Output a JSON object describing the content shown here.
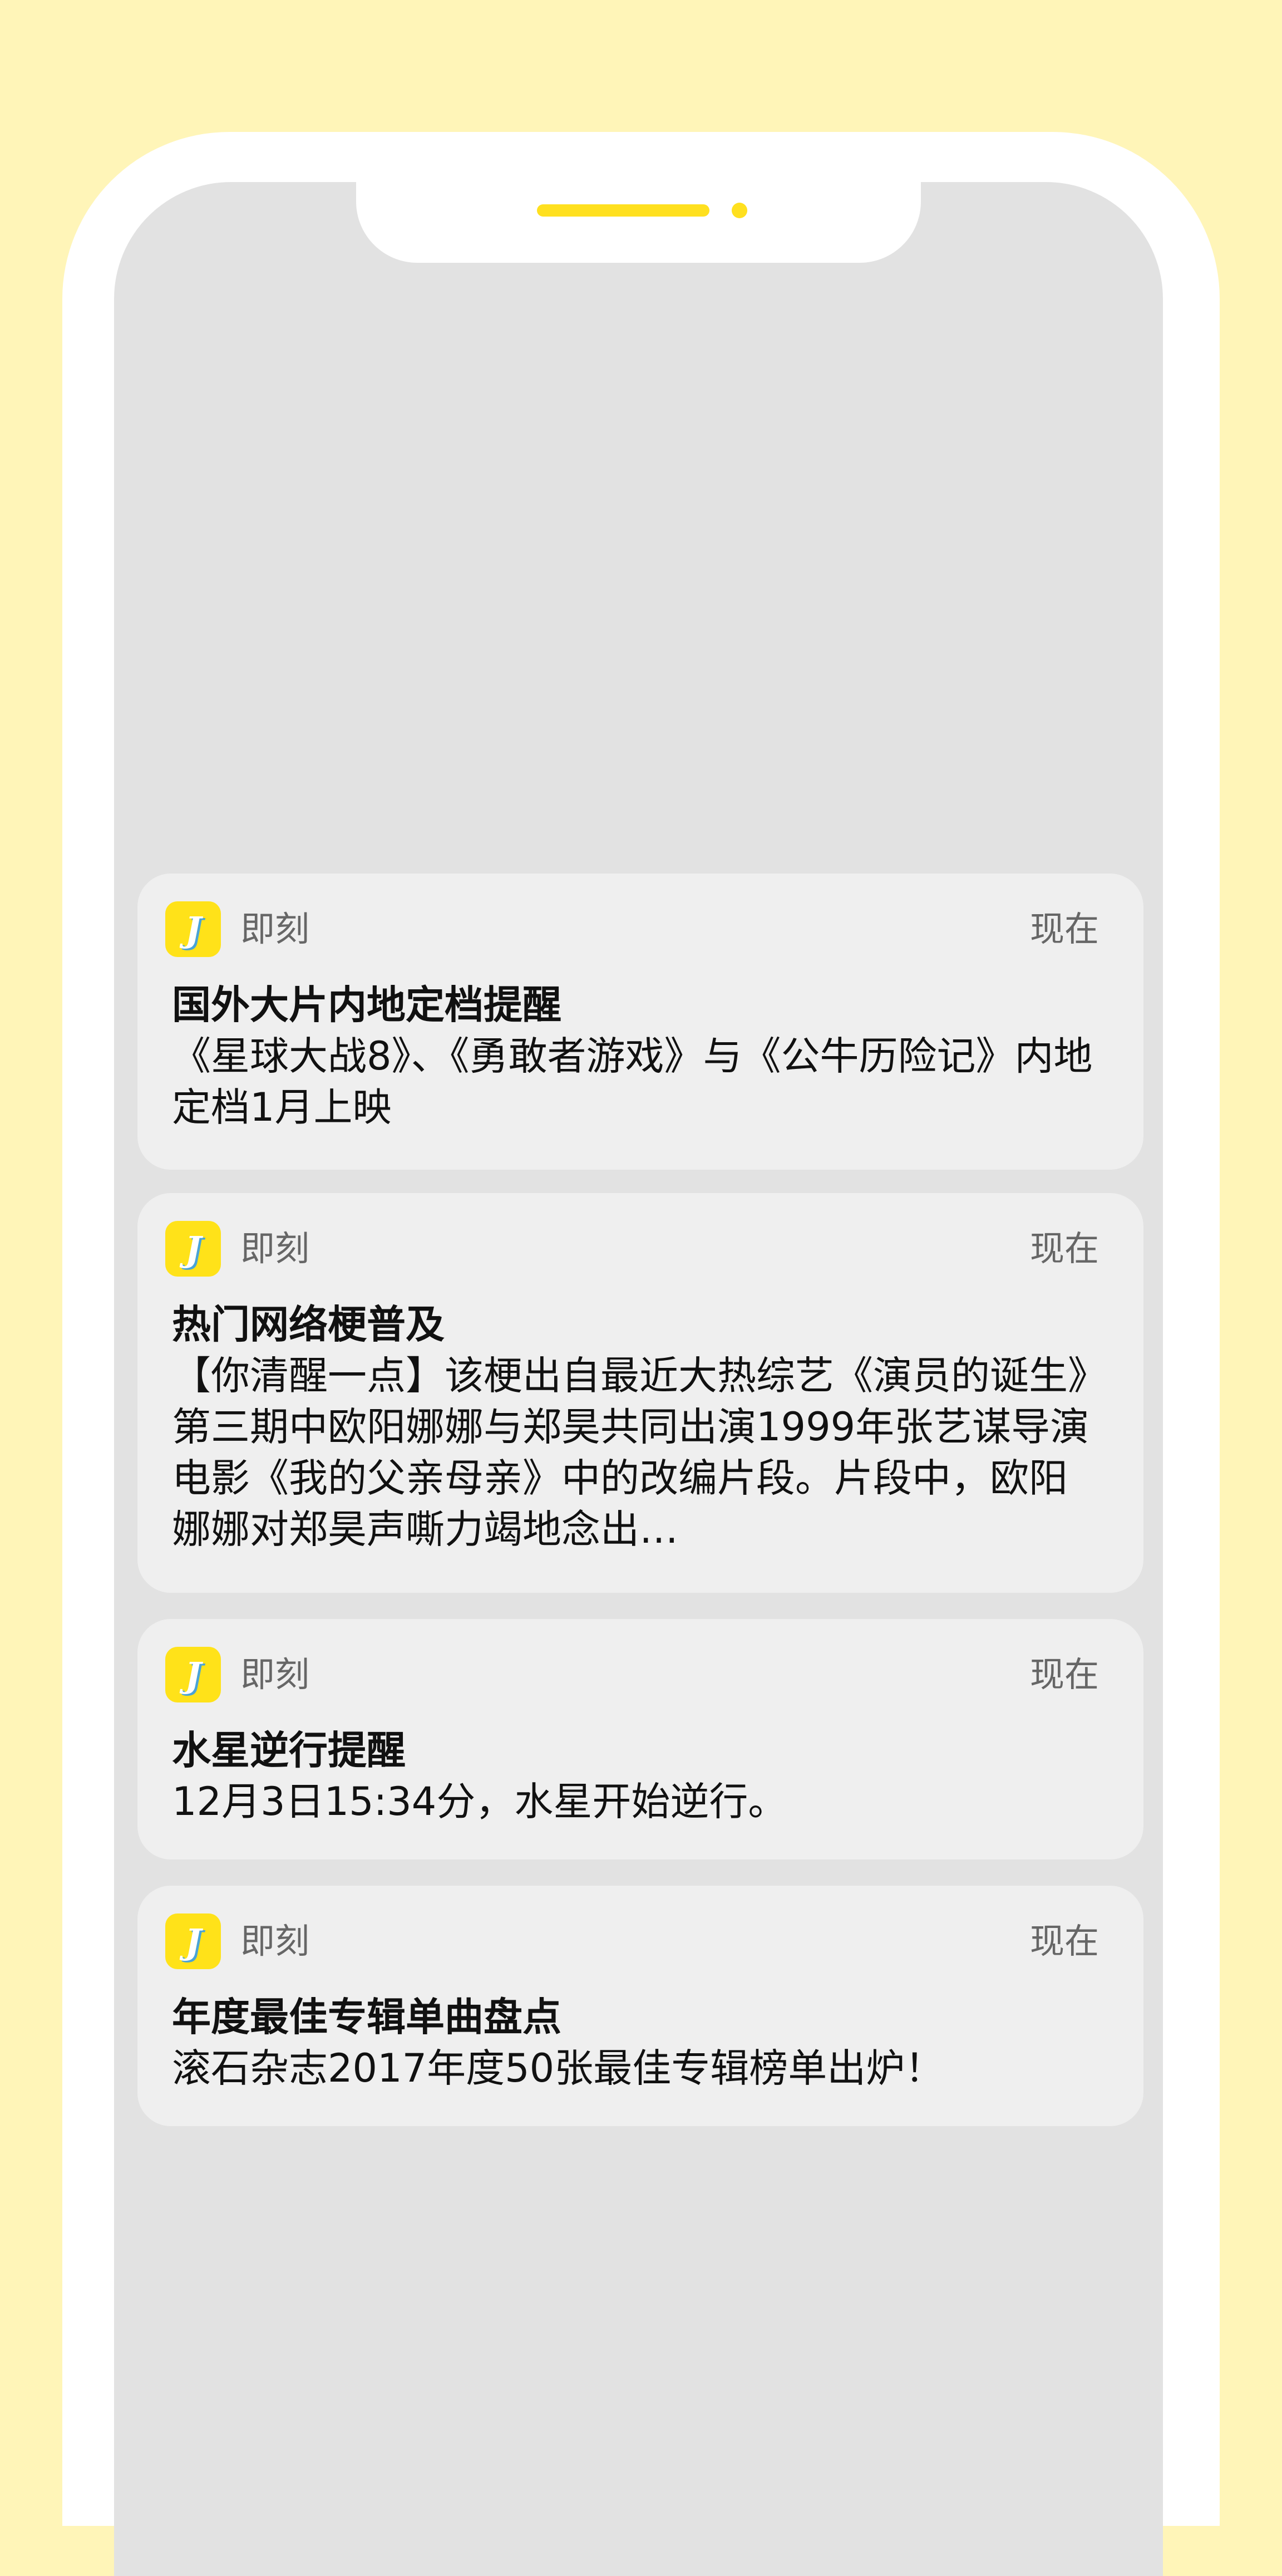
{
  "colors": {
    "background": "#fff5b8",
    "accent": "#ffe01f",
    "card": "#efefef",
    "screen": "#e2e2e2"
  },
  "app_icon": {
    "name": "jike-app-icon",
    "letter": "J"
  },
  "notifications": [
    {
      "app": "即刻",
      "time": "现在",
      "title": "国外大片内地定档提醒",
      "body": "《星球大战8》、《勇敢者游戏》与《公牛历险记》内地定档1月上映"
    },
    {
      "app": "即刻",
      "time": "现在",
      "title": "热门网络梗普及",
      "body": "【你清醒一点】该梗出自最近大热综艺《演员的诞生》第三期中欧阳娜娜与郑昊共同出演1999年张艺谋导演电影《我的父亲母亲》中的改编片段。片段中，欧阳娜娜对郑昊声嘶力竭地念出…"
    },
    {
      "app": "即刻",
      "time": "现在",
      "title": "水星逆行提醒",
      "body": "12月3日15:34分，水星开始逆行。"
    },
    {
      "app": "即刻",
      "time": "现在",
      "title": "年度最佳专辑单曲盘点",
      "body": "滚石杂志2017年度50张最佳专辑榜单出炉！"
    }
  ]
}
